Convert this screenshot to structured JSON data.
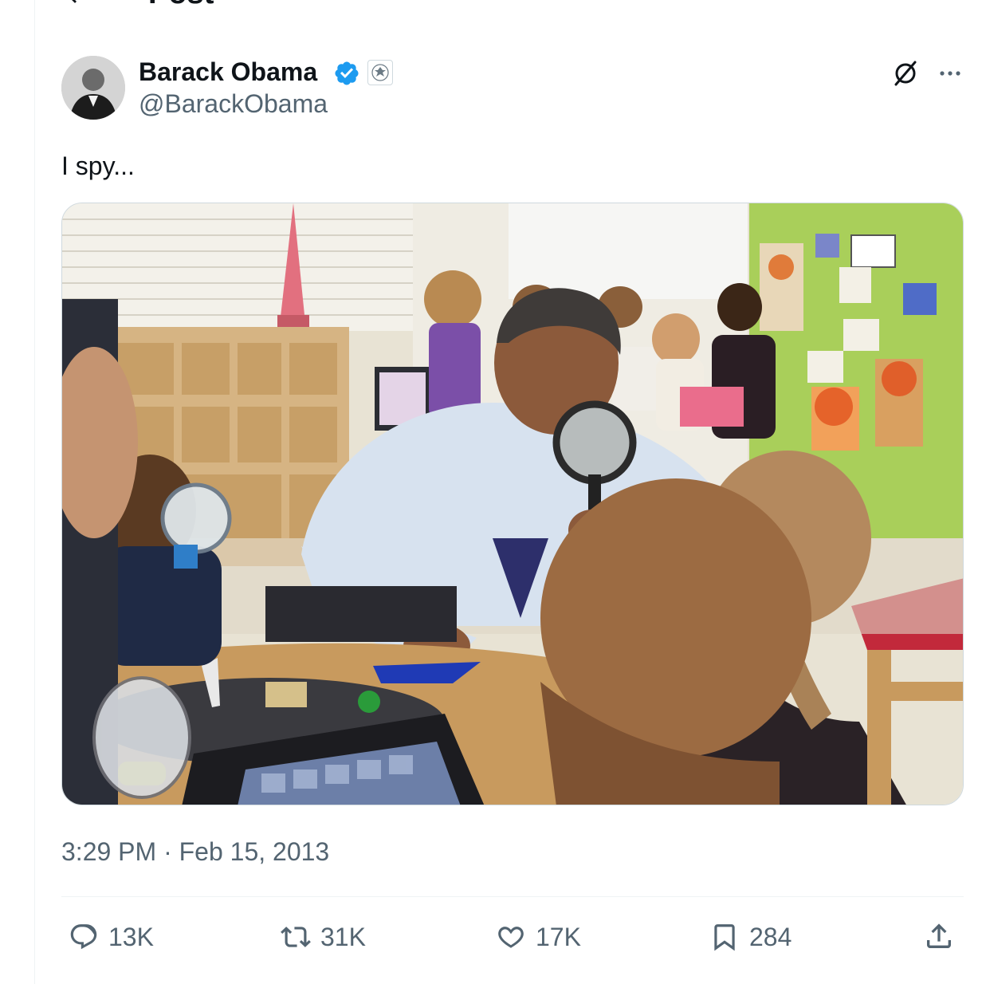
{
  "header": {
    "title": "Post",
    "back_icon": "arrow-left-icon"
  },
  "author": {
    "display_name": "Barack Obama",
    "handle": "@BarackObama",
    "verified_icon": "verified-badge-icon",
    "affiliation_icon": "government-seal-icon",
    "verified_color": "#1d9bf0"
  },
  "top_actions": {
    "grok_icon": "grok-icon",
    "more_icon": "more-dots-icon"
  },
  "post": {
    "text": "I spy...",
    "timestamp": "3:29 PM · Feb 15, 2013",
    "media": {
      "type": "photo"
    }
  },
  "engagement": {
    "replies": {
      "icon": "reply-icon",
      "count": "13K"
    },
    "reposts": {
      "icon": "repost-icon",
      "count": "31K"
    },
    "likes": {
      "icon": "heart-icon",
      "count": "17K"
    },
    "bookmarks": {
      "icon": "bookmark-icon",
      "count": "284"
    },
    "share": {
      "icon": "share-icon"
    }
  },
  "colors": {
    "text": "#0f1419",
    "secondary": "#536471",
    "border": "#cfd9de",
    "divider": "#eff3f4"
  }
}
